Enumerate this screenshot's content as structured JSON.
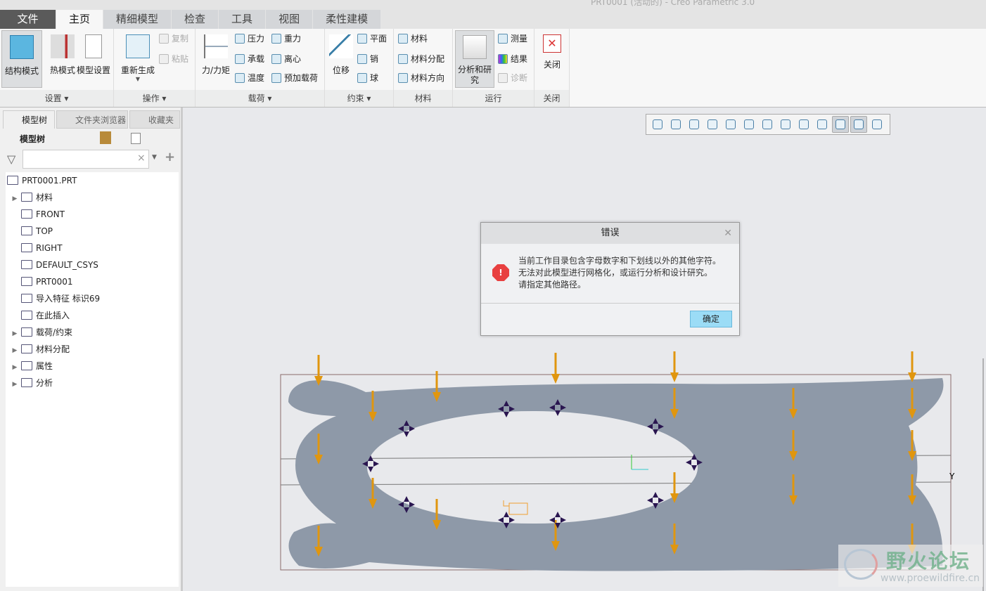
{
  "window": {
    "title": "PRT0001 (活动的) - Creo Parametric 3.0"
  },
  "tabs": [
    {
      "label": "文件"
    },
    {
      "label": "主页"
    },
    {
      "label": "精细模型"
    },
    {
      "label": "检查"
    },
    {
      "label": "工具"
    },
    {
      "label": "视图"
    },
    {
      "label": "柔性建模"
    }
  ],
  "ribbon": {
    "setup": {
      "label": "设置",
      "structure": "结构模式",
      "thermal": "热模式",
      "model_setup": "模型设置"
    },
    "ops": {
      "label": "操作",
      "regen": "重新生成",
      "copy": "复制",
      "paste": "粘贴"
    },
    "loads": {
      "label": "载荷",
      "force": "力/力矩",
      "pressure": "压力",
      "gravity": "重力",
      "bearing": "承载",
      "centrifugal": "离心",
      "temperature": "温度",
      "preload": "预加载荷"
    },
    "constraints": {
      "label": "约束",
      "displacement": "位移",
      "plane": "平面",
      "pin": "销",
      "ball": "球"
    },
    "materials": {
      "label": "材料",
      "material": "材料",
      "assign": "材料分配",
      "orient": "材料方向"
    },
    "run": {
      "label": "运行",
      "analysis": "分析和研究",
      "measure": "测量",
      "results": "结果",
      "diagnose": "诊断"
    },
    "close": {
      "label": "关闭",
      "button": "关闭"
    }
  },
  "panel": {
    "tabs": [
      {
        "label": "模型树"
      },
      {
        "label": "文件夹浏览器"
      },
      {
        "label": "收藏夹"
      }
    ],
    "header": "模型树",
    "search": {
      "value": "",
      "placeholder": ""
    },
    "tree": [
      {
        "label": "PRT0001.PRT",
        "expand": false,
        "indent": 0,
        "icon": "part-icon"
      },
      {
        "label": "材料",
        "expand": true,
        "indent": 1,
        "icon": "material-icon"
      },
      {
        "label": "FRONT",
        "expand": false,
        "indent": 1,
        "icon": "datum-plane-icon"
      },
      {
        "label": "TOP",
        "expand": false,
        "indent": 1,
        "icon": "datum-plane-icon"
      },
      {
        "label": "RIGHT",
        "expand": false,
        "indent": 1,
        "icon": "datum-plane-icon"
      },
      {
        "label": "DEFAULT_CSYS",
        "expand": false,
        "indent": 1,
        "icon": "csys-icon"
      },
      {
        "label": "PRT0001",
        "expand": false,
        "indent": 1,
        "icon": "csys-icon"
      },
      {
        "label": "导入特征 标识69",
        "expand": false,
        "indent": 1,
        "icon": "import-feature-icon"
      },
      {
        "label": "在此插入",
        "expand": false,
        "indent": 1,
        "icon": "insert-here-icon"
      },
      {
        "label": "载荷/约束",
        "expand": true,
        "indent": 1,
        "icon": "loads-icon"
      },
      {
        "label": "材料分配",
        "expand": true,
        "indent": 1,
        "icon": "material-assign-icon"
      },
      {
        "label": "属性",
        "expand": true,
        "indent": 1,
        "icon": "properties-icon"
      },
      {
        "label": "分析",
        "expand": true,
        "indent": 1,
        "icon": "analysis-icon"
      }
    ]
  },
  "dialog": {
    "title": "错误",
    "lines": [
      "当前工作目录包含字母数字和下划线以外的其他字符。",
      "无法对此模型进行网格化，或运行分析和设计研究。",
      "请指定其他路径。"
    ],
    "ok": "确定"
  },
  "viewport": {
    "axis_label": "Y"
  },
  "watermark": {
    "text": "野火论坛",
    "url": "www.proewildfire.cn"
  },
  "colors": {
    "load_arrow": "#e0960f",
    "model": "#8e99a8",
    "constraint": "#2a1650",
    "ok_button": "#9bdcf6",
    "error": "#e84040"
  }
}
